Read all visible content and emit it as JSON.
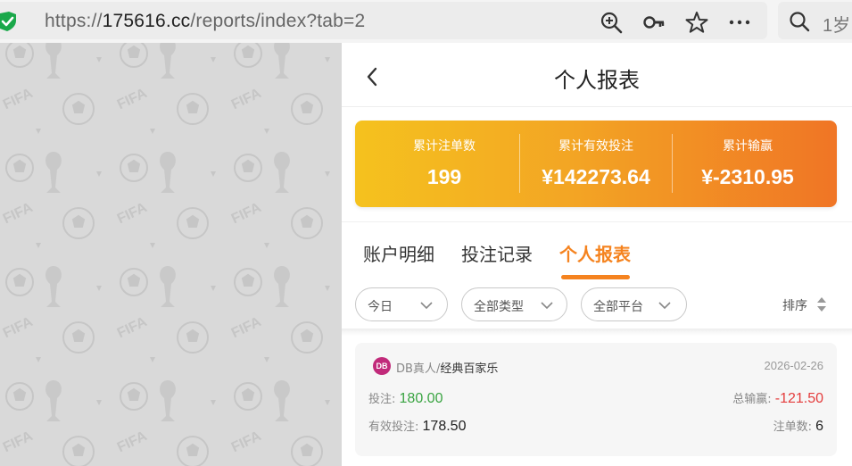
{
  "browser": {
    "url_prefix": "https://",
    "url_host": "175616.cc",
    "url_path": "/reports/index?tab=2",
    "search_text": "1岁",
    "icons": [
      "shield-check-icon",
      "zoom-in-icon",
      "key-icon",
      "star-icon",
      "more-icon",
      "search-icon"
    ]
  },
  "header": {
    "title": "个人报表"
  },
  "stats": [
    {
      "label": "累计注单数",
      "value": "199"
    },
    {
      "label": "累计有效投注",
      "value": "¥142273.64"
    },
    {
      "label": "累计输赢",
      "value": "¥-2310.95"
    }
  ],
  "tabs": [
    {
      "label": "账户明细"
    },
    {
      "label": "投注记录"
    },
    {
      "label": "个人报表"
    }
  ],
  "filters": {
    "date": "今日",
    "type": "全部类型",
    "platform": "全部平台",
    "sort": "排序"
  },
  "record": {
    "logo_text": "DB",
    "provider": "DB真人",
    "separator": "/",
    "game": "经典百家乐",
    "date": "2026-02-26",
    "bet_label": "投注:",
    "bet_value": "180.00",
    "winloss_label": "总输赢:",
    "winloss_value": "-121.50",
    "valid_bet_label": "有效投注:",
    "valid_bet_value": "178.50",
    "count_label": "注单数:",
    "count_value": "6"
  },
  "colors": {
    "accent": "#f5831f",
    "gradient_start": "#f5c21e",
    "gradient_end": "#f07525",
    "positive": "#3aa442",
    "negative": "#e43c3c"
  }
}
